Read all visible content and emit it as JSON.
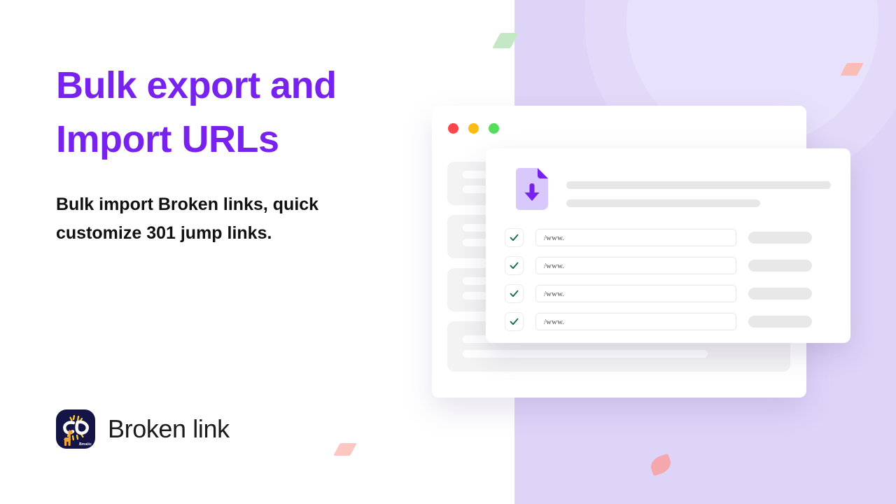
{
  "hero": {
    "headline": "Bulk export and Import URLs",
    "subheadline": "Bulk import Broken links, quick customize 301 jump links.",
    "headline_color": "#7722ee",
    "subheadline_color": "#111111"
  },
  "brand": {
    "name": "Broken link",
    "mark_badge_text": "Bmatic",
    "mark_background": "#141446",
    "mark_icon": "broken-chain-link-icon"
  },
  "background": {
    "left_panel_color": "#ffffff",
    "right_panel_color": "#ded4f8",
    "decor_circle_color": "#e8e1fb",
    "confetti": [
      {
        "name": "green-rhombus",
        "color": "#c4e8c4"
      },
      {
        "name": "pink-rhombus-left",
        "color": "#fbc7c0"
      },
      {
        "name": "pink-rhombus-top",
        "color": "#f9bdb5"
      },
      {
        "name": "pink-leaf-bottom",
        "color": "#f4a8ae"
      }
    ]
  },
  "browser_window": {
    "traffic_lights": [
      {
        "name": "close-dot",
        "color": "#f8464a"
      },
      {
        "name": "minimize-dot",
        "color": "#fcbc12"
      },
      {
        "name": "maximize-dot",
        "color": "#54dd5a"
      }
    ],
    "skeleton_cards": 4
  },
  "modal": {
    "icon": "file-download-icon",
    "icon_color": "#7722ee",
    "icon_background": "#d9c8fb",
    "header_placeholder_bars": 2,
    "rows": [
      {
        "checked": true,
        "url_value": "/www.",
        "check_color": "#1d6b4a"
      },
      {
        "checked": true,
        "url_value": "/www.",
        "check_color": "#1d6b4a"
      },
      {
        "checked": true,
        "url_value": "/www.",
        "check_color": "#1d6b4a"
      },
      {
        "checked": true,
        "url_value": "/www.",
        "check_color": "#1d6b4a"
      }
    ]
  }
}
